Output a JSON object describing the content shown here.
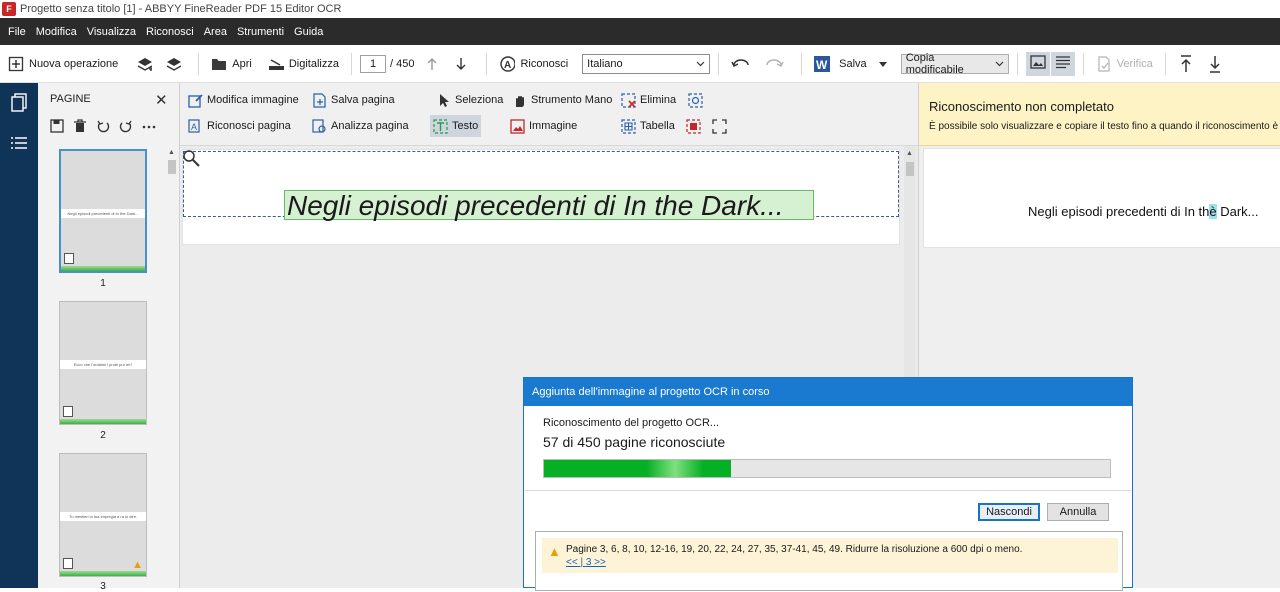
{
  "window": {
    "title": "Progetto senza titolo [1] - ABBYY FineReader PDF 15 Editor OCR"
  },
  "menu": [
    "File",
    "Modifica",
    "Visualizza",
    "Riconosci",
    "Area",
    "Strumenti",
    "Guida"
  ],
  "toolbar": {
    "new_task": "Nuova operazione",
    "open": "Apri",
    "scan": "Digitalizza",
    "page_current": "1",
    "page_total": "/ 450",
    "recognize": "Riconosci",
    "language": "Italiano",
    "save": "Salva",
    "save_format": "Copia modificabile",
    "verify": "Verifica"
  },
  "pages_panel": {
    "title": "PAGINE",
    "thumbnails": [
      {
        "number": "1",
        "text": "Negli episodi precedenti di In the Dark..."
      },
      {
        "number": "2",
        "text": "Ecco che l'ordalmi i probi pur lei?"
      },
      {
        "number": "3",
        "text": "Tu mestieri in tua impregia a ra lo dire."
      }
    ]
  },
  "edit_tools": {
    "edit_image": "Modifica immagine",
    "save_page": "Salva pagina",
    "select": "Seleziona",
    "hand_tool": "Strumento Mano",
    "delete": "Elimina",
    "recognize_page": "Riconosci pagina",
    "analyze_page": "Analizza pagina",
    "text": "Testo",
    "image": "Immagine",
    "table": "Tabella"
  },
  "image_view": {
    "recognized_text": "Negli episodi precedenti di In the Dark..."
  },
  "text_panel": {
    "notice_title": "Riconoscimento non completato",
    "notice_desc": "È possibile solo visualizzare e copiare il testo fino a quando il riconoscimento è",
    "line_before": "Negli episodi precedenti di In th",
    "line_highlight": "è",
    "line_after": " Dark..."
  },
  "dialog": {
    "title": "Aggiunta dell'immagine al progetto OCR in corso",
    "status": "Riconoscimento del progetto OCR...",
    "progress_text": "57 di 450 pagine riconosciute",
    "progress_fraction": 0.33,
    "hide_button": "Nascondi",
    "cancel_button": "Annulla",
    "warning_text": "Pagine 3, 6, 8, 10, 12-16, 19, 20, 22, 24, 27, 35, 37-41, 45, 49. Ridurre la risoluzione a 600 dpi o meno.",
    "nav_prev": "<<",
    "nav_next": "3 >>"
  },
  "colors": {
    "menubar": "#2b2b2b",
    "sidebar": "#0f3457",
    "dialog_title": "#1a7ad0",
    "notice_bg": "#fdf3c4",
    "progress": "#06b025"
  }
}
